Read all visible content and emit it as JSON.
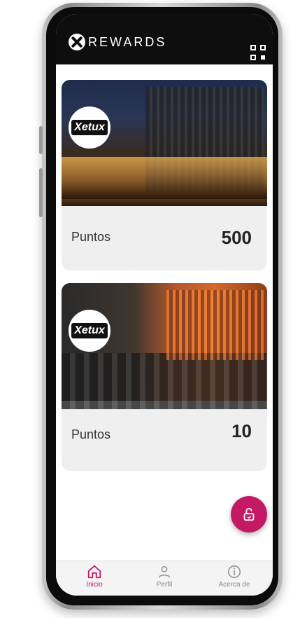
{
  "app": {
    "brand_text": "REWARDS"
  },
  "header": {
    "qr_icon": "qr-code-icon"
  },
  "cards": [
    {
      "logo_text": "Xetux",
      "image": "bar-exterior-photo",
      "points_label": "Puntos",
      "points_value": "500"
    },
    {
      "logo_text": "Xetux",
      "image": "restaurant-interior-photo",
      "points_label": "Puntos",
      "points_value": "10"
    }
  ],
  "fab": {
    "icon": "unlock-icon"
  },
  "nav": {
    "items": [
      {
        "label": "Inicio",
        "icon": "home-icon",
        "active": true
      },
      {
        "label": "Perfil",
        "icon": "user-icon",
        "active": false
      },
      {
        "label": "Acerca de",
        "icon": "info-icon",
        "active": false
      }
    ]
  },
  "colors": {
    "accent": "#c41a66",
    "header_bg": "#0e0e0e",
    "card_bg": "#efefef"
  }
}
